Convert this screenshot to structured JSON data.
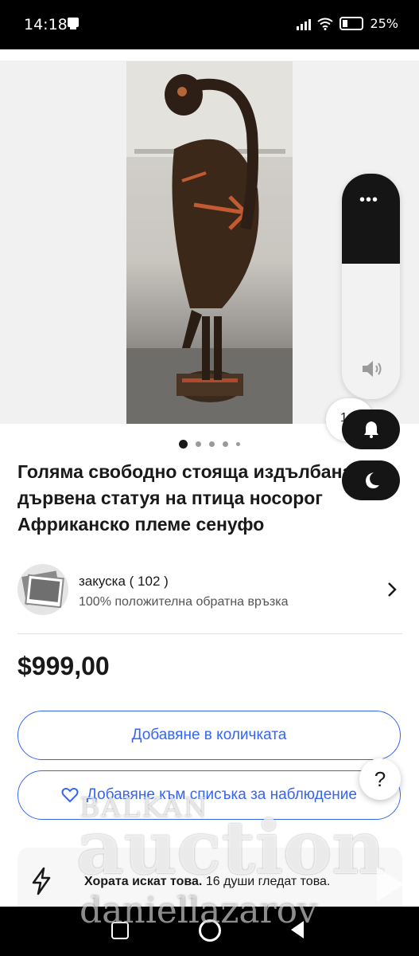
{
  "status_bar": {
    "time": "14:18",
    "battery": "25%"
  },
  "listing": {
    "title": "Голяма свободно стояща издълбана дървена статуя на птица носорог Африканско племе сенуфо",
    "seller_name": "закуска ( 102 )",
    "seller_feedback": "100% положителна обратна връзка",
    "price": "$999,00",
    "add_to_cart": "Добавяне в количката",
    "add_to_watchlist": "Добавяне към списъка за наблюдение",
    "insight_bold": "Хората искат това.",
    "insight_rest": " 16 души гледат това."
  },
  "overlay": {
    "help": "?",
    "more": "•••",
    "partial_value": "1 ..."
  },
  "watermark": {
    "line1": "BALKAN",
    "line2": "auction",
    "line3": "daniellazarov"
  },
  "colors": {
    "accent": "#3665f3",
    "text": "#191919"
  }
}
